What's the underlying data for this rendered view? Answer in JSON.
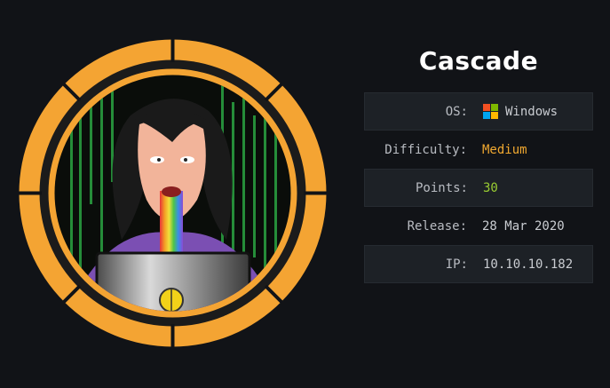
{
  "machine": {
    "name": "Cascade",
    "avatar": {
      "icon": "machine-avatar",
      "ring_color": "#f4a433"
    },
    "info": [
      {
        "label": "OS:",
        "value": "Windows",
        "icon": "windows-icon",
        "style": "normal"
      },
      {
        "label": "Difficulty:",
        "value": "Medium",
        "style": "medium"
      },
      {
        "label": "Points:",
        "value": "30",
        "style": "points"
      },
      {
        "label": "Release:",
        "value": "28 Mar 2020",
        "style": "normal"
      },
      {
        "label": "IP:",
        "value": "10.10.10.182",
        "style": "normal"
      }
    ]
  },
  "colors": {
    "background": "#111317",
    "row_shade": "#1d2126",
    "difficulty_medium": "#f0a830",
    "points": "#9acd32",
    "windows_red": "#f25022",
    "windows_green": "#7fba00",
    "windows_blue": "#00a4ef",
    "windows_yellow": "#ffb900"
  }
}
